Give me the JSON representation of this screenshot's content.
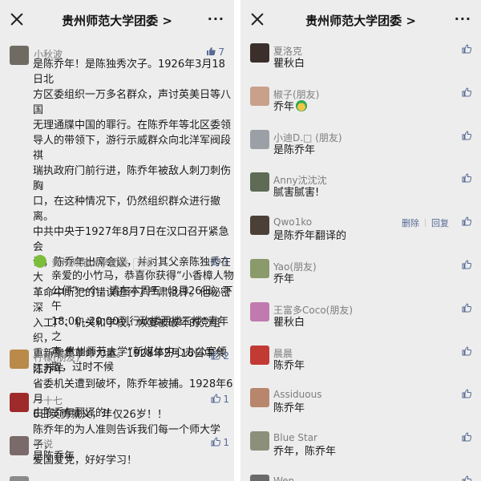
{
  "left": {
    "header": {
      "title": "贵州师范大学团委 >",
      "more": "···"
    },
    "comments": [
      {
        "name": "小秋波",
        "likes": "7",
        "liked": true,
        "avatar_color": "#6f6b63",
        "lines": [
          "是陈乔年！是陈独秀次子。1926年3月18日北",
          "方区委组织一万多名群众，声讨英美日等八国",
          "无理通牒中国的罪行。在陈乔年等北区委领",
          "导人的带领下，游行示威群众向北洋军阀段祺",
          "瑞执政府门前行进，陈乔年被敌人刺刀刺伤胸",
          "口，在这种情况下，仍然组织群众进行撤离。",
          "中共中央于1927年8月7日在汉口召开紧急会",
          "议，陈乔年出席会议，并对其父亲陈独秀在大",
          "革命中所犯的错误进行了严肃批评。他秘密深",
          "入工厂、机关和学校，恢复被破坏的党组织，",
          "重新聚集革命力量。1928年2月16日中共江苏",
          "省委机关遭到破坏，陈乔年被捕。1928年6月",
          "6日英勇就义，年仅26岁！！",
          "陈乔年的为人准则告诉我们每一个师大学子，",
          "爱国爱党，好好学习！"
        ],
        "reply": {
          "name": "贵州师范大学团委",
          "tag": "作者",
          "likes": "1",
          "lines": [
            "亲爱的小竹马，恭喜你获得“小香樟人物",
            "公仔”一个，请在本周五（3月26日）下午",
            "18:00--20:00到行政楼西楼三楼“青年之",
            "声·贵州师范大学”新媒体中心办公室领",
            "取，过时不候"
          ]
        }
      },
      {
        "name": "柠檬(朋友)",
        "text": "陈乔年",
        "likes": "2",
        "avatar_color": "#b98a4a"
      },
      {
        "name": "一十七",
        "text": "由陈乔年翻译的！",
        "likes": "1",
        "avatar_color": "#9e2a2a"
      },
      {
        "name": "听说",
        "text": "是陈乔年",
        "likes": "1",
        "avatar_color": "#7a6a6a"
      }
    ]
  },
  "right": {
    "header": {
      "title": "贵州师范大学团委 >",
      "more": "···"
    },
    "comments": [
      {
        "name": "夏洛克",
        "text": "瞿秋白",
        "avatar_color": "#3a2f2a"
      },
      {
        "name": "椒子(朋友)",
        "text": "乔年",
        "emoji": "turtle-emoji",
        "avatar_color": "#c9a08a"
      },
      {
        "name": "小迪D.□ (朋友)",
        "text": "是陈乔年",
        "avatar_color": "#9aa0a6"
      },
      {
        "name": "Anny沈沈沈",
        "text": "腻害腻害!",
        "avatar_color": "#5f6b55"
      },
      {
        "name": "Qwo1ko",
        "text": "是陈乔年翻译的",
        "avatar_color": "#4a4037",
        "actions": {
          "delete": "删除",
          "reply": "回复"
        }
      },
      {
        "name": "Yao(朋友)",
        "text": "乔年",
        "avatar_color": "#8a9a6a"
      },
      {
        "name": "王富多Coco(朋友)",
        "text": "瞿秋白",
        "avatar_color": "#c07ab0"
      },
      {
        "name": "晨晨",
        "text": "陈乔年",
        "avatar_color": "#c23a34"
      },
      {
        "name": "Assiduous",
        "text": "陈乔年",
        "avatar_color": "#b8866c"
      },
      {
        "name": "Blue Star",
        "text": "乔年，陈乔年",
        "avatar_color": "#8c8f7a"
      },
      {
        "name": "Wen",
        "text": "",
        "avatar_color": "#6a6a6a"
      }
    ]
  },
  "colors": {
    "link": "#576b95",
    "background": "#ededed",
    "name": "#7d7d7d"
  }
}
